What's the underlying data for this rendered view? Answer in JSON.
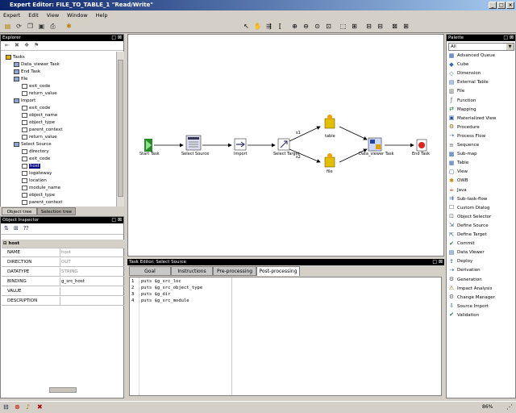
{
  "window": {
    "title": "Expert  Editor: FILE_TO_TABLE_1 \"Read/Write\""
  },
  "menu": [
    "Expert",
    "Edit",
    "View",
    "Window",
    "Help"
  ],
  "explorer": {
    "title": "Explorer",
    "tree": [
      {
        "label": "Tasks",
        "indent": 0
      },
      {
        "label": "Data_viewer Task",
        "indent": 1
      },
      {
        "label": "End Task",
        "indent": 1
      },
      {
        "label": "file",
        "indent": 1
      },
      {
        "label": "exit_code",
        "indent": 2
      },
      {
        "label": "return_value",
        "indent": 2
      },
      {
        "label": "Import",
        "indent": 1
      },
      {
        "label": "exit_code",
        "indent": 2
      },
      {
        "label": "object_name",
        "indent": 2
      },
      {
        "label": "object_type",
        "indent": 2
      },
      {
        "label": "parent_context",
        "indent": 2
      },
      {
        "label": "return_value",
        "indent": 2
      },
      {
        "label": "Select Source",
        "indent": 1
      },
      {
        "label": "directory",
        "indent": 2
      },
      {
        "label": "exit_code",
        "indent": 2
      },
      {
        "label": "host",
        "indent": 2,
        "selected": true
      },
      {
        "label": "logateway",
        "indent": 2
      },
      {
        "label": "location",
        "indent": 2
      },
      {
        "label": "module_name",
        "indent": 2
      },
      {
        "label": "object_type",
        "indent": 2
      },
      {
        "label": "parent_context",
        "indent": 2
      }
    ],
    "tabs": [
      "Object tree",
      "Selection tree"
    ]
  },
  "inspector": {
    "title": "Object Inspector",
    "header": "host",
    "rows": [
      {
        "key": "NAME",
        "value": "host"
      },
      {
        "key": "DIRECTION",
        "value": "OUT"
      },
      {
        "key": "DATATYPE",
        "value": "STRING"
      },
      {
        "key": "BINDING",
        "value": "g_src_host"
      },
      {
        "key": "VALUE",
        "value": ""
      },
      {
        "key": "DESCRIPTION",
        "value": ""
      }
    ]
  },
  "canvas": {
    "nodes": [
      "Start Task",
      "Select Source",
      "Import",
      "Select Target",
      "table",
      "file",
      "Data_viewer Task",
      "End Task"
    ],
    "edge_labels": [
      "s1",
      "s2"
    ]
  },
  "task_editor": {
    "title": "Task Editor: Select Source",
    "tabs": [
      "Goal",
      "Instructions",
      "Pre-processing",
      "Post-processing"
    ],
    "code_lines": [
      {
        "num": "1",
        "text": "puts $g_src_loc"
      },
      {
        "num": "2",
        "text": "puts $g_src_object_type"
      },
      {
        "num": "3",
        "text": "puts $g_dir"
      },
      {
        "num": "4",
        "text": "puts $g_src_module"
      }
    ]
  },
  "palette": {
    "title": "Palette",
    "filter": "All",
    "items": [
      "Advanced Queue",
      "Cube",
      "Dimension",
      "External Table",
      "File",
      "Function",
      "Mapping",
      "Materialized View",
      "Procedure",
      "Process Flow",
      "Sequence",
      "Sub-map",
      "Table",
      "View",
      "OWB",
      "Java",
      "Sub-task-flow",
      "Custom Dialog",
      "Object Selector",
      "Define Source",
      "Define Target",
      "Commit",
      "Data Viewer",
      "Deploy",
      "Derivation",
      "Generation",
      "Impact Analysis",
      "Change Manager",
      "Source Import",
      "Validation"
    ]
  },
  "status": {
    "zoom": "86%"
  }
}
